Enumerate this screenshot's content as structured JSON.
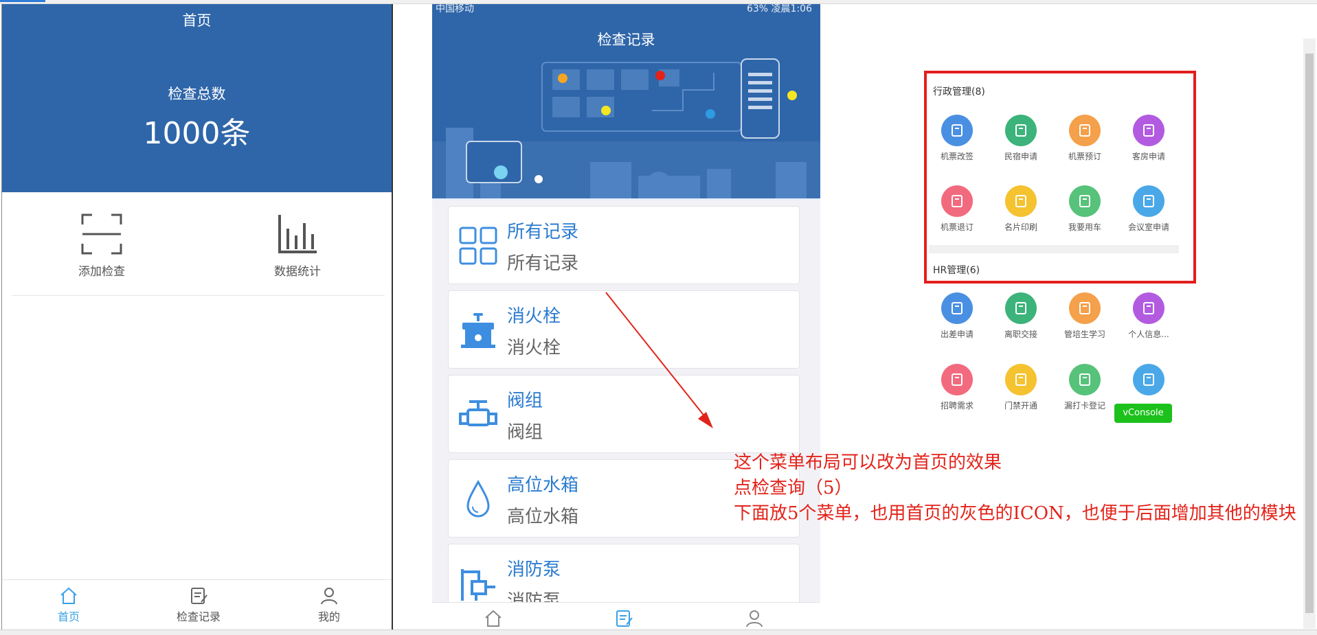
{
  "home": {
    "title": "首页",
    "total_label": "检查总数",
    "total_value": "1000条",
    "shortcuts": [
      {
        "label": "添加检查",
        "icon": "scan-icon"
      },
      {
        "label": "数据统计",
        "icon": "bar-chart-icon"
      }
    ],
    "tabs": [
      {
        "label": "首页",
        "icon": "home-icon"
      },
      {
        "label": "检查记录",
        "icon": "record-icon"
      },
      {
        "label": "我的",
        "icon": "user-icon"
      }
    ],
    "accent": "#2f66a9",
    "active_tab_color": "#3aa0e6"
  },
  "records": {
    "status_left": "中国移动",
    "status_right": "63% 凌晨1:06",
    "title": "检查记录",
    "items": [
      {
        "title": "所有记录",
        "subtitle": "所有记录",
        "icon": "grid-icon"
      },
      {
        "title": "消火栓",
        "subtitle": "消火栓",
        "icon": "hydrant-icon"
      },
      {
        "title": "阀组",
        "subtitle": "阀组",
        "icon": "valve-icon"
      },
      {
        "title": "高位水箱",
        "subtitle": "高位水箱",
        "icon": "water-drop-icon"
      },
      {
        "title": "消防泵",
        "subtitle": "消防泵",
        "icon": "pump-icon"
      }
    ]
  },
  "menu": {
    "section1_title": "行政管理(8)",
    "section1_items": [
      {
        "label": "机票改签",
        "color": "#4a90e2"
      },
      {
        "label": "民宿申请",
        "color": "#3cb37a"
      },
      {
        "label": "机票预订",
        "color": "#f5a04a"
      },
      {
        "label": "客房申请",
        "color": "#b25be0"
      },
      {
        "label": "机票退订",
        "color": "#f26a7e"
      },
      {
        "label": "名片印刷",
        "color": "#f5c230"
      },
      {
        "label": "我要用车",
        "color": "#57c27a"
      },
      {
        "label": "会议室申请",
        "color": "#4aa8e8"
      }
    ],
    "section2_title": "HR管理(6)",
    "section2_items": [
      {
        "label": "出差申请",
        "color": "#4a90e2"
      },
      {
        "label": "离职交接",
        "color": "#3cb37a"
      },
      {
        "label": "管培生学习",
        "color": "#f5a04a"
      },
      {
        "label": "个人信息...",
        "color": "#b25be0"
      },
      {
        "label": "招聘需求",
        "color": "#f26a7e"
      },
      {
        "label": "门禁开通",
        "color": "#f5c230"
      },
      {
        "label": "漏打卡登记",
        "color": "#57c27a"
      },
      {
        "label": "",
        "color": "#4aa8e8"
      }
    ],
    "vconsole_label": "vConsole"
  },
  "annotation": {
    "lines": [
      "这个菜单布局可以改为首页的效果",
      "点检查询（5）",
      "下面放5个菜单，也用首页的灰色的ICON，也便于后面增加其他的模块"
    ],
    "color": "#e2231a"
  }
}
